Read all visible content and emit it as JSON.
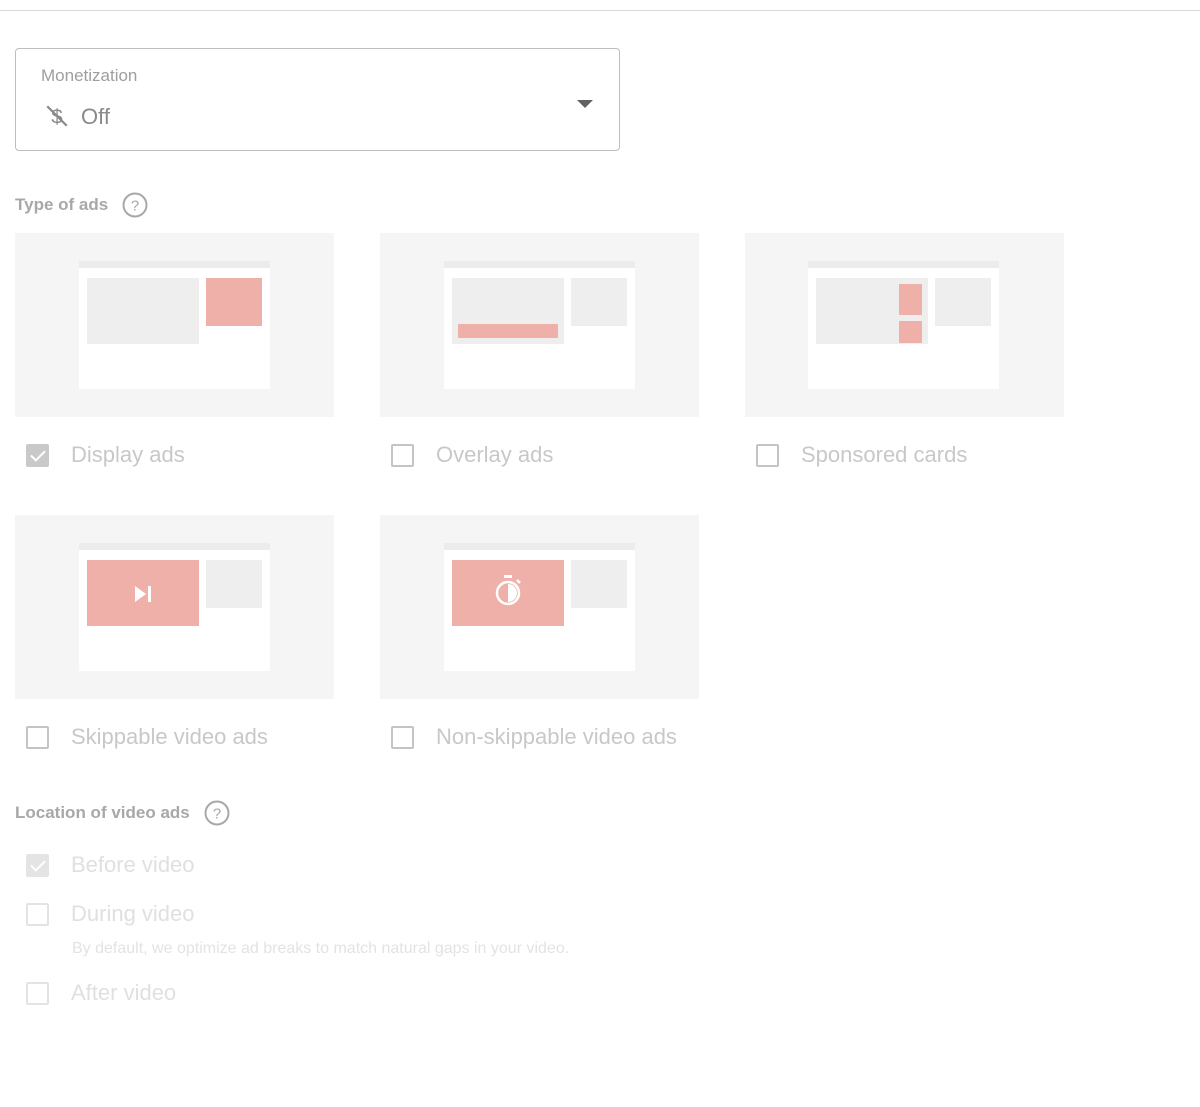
{
  "monetization": {
    "label": "Monetization",
    "value": "Off",
    "icon": "money-off-icon"
  },
  "ad_types": {
    "title": "Type of ads",
    "items": [
      {
        "label": "Display ads",
        "checked": true
      },
      {
        "label": "Overlay ads",
        "checked": false
      },
      {
        "label": "Sponsored cards",
        "checked": false
      },
      {
        "label": "Skippable video ads",
        "checked": false
      },
      {
        "label": "Non-skippable video ads",
        "checked": false
      }
    ]
  },
  "ad_location": {
    "title": "Location of video ads",
    "items": [
      {
        "label": "Before video",
        "checked": true
      },
      {
        "label": "During video",
        "checked": false
      },
      {
        "label": "After video",
        "checked": false
      }
    ],
    "hint": "By default, we optimize ad breaks to match natural gaps in your video."
  },
  "colors": {
    "preview_ad": "#f0b0aa",
    "preview_block": "#eeeeee",
    "card_bg": "#f5f5f5"
  }
}
